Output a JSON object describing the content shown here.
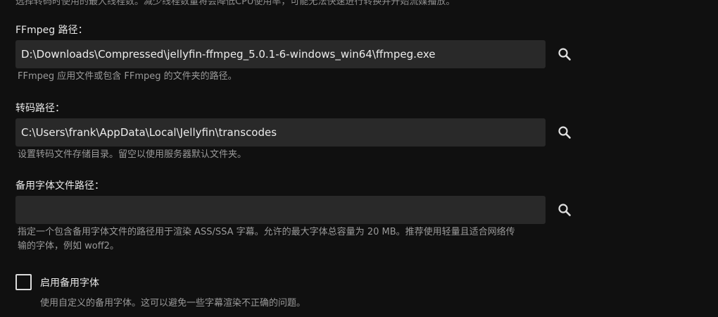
{
  "top_partial_text": "选择转码时使用的最大线程数。减少线程数量将会降低CPU使用率，可能无法快速进行转换并开始流媒播放。",
  "ffmpeg": {
    "label": "FFmpeg 路径：",
    "value": "D:\\Downloads\\Compressed\\jellyfin-ffmpeg_5.0.1-6-windows_win64\\ffmpeg.exe",
    "description": "FFmpeg 应用文件或包含 FFmpeg 的文件夹的路径。",
    "icon": "search-icon"
  },
  "transcode": {
    "label": "转码路径：",
    "value": "C:\\Users\\frank\\AppData\\Local\\Jellyfin\\transcodes",
    "description": "设置转码文件存储目录。留空以使用服务器默认文件夹。",
    "icon": "search-icon"
  },
  "fallback_font": {
    "label": "备用字体文件路径：",
    "value": "",
    "description_line1": "指定一个包含备用字体文件的路径用于渲染 ASS/SSA 字幕。允许的最大字体总容量为 20 MB。推荐使用轻量且适合网络传",
    "description_line2": "输的字体，例如 woff2。",
    "icon": "search-icon"
  },
  "enable_fallback_font": {
    "label": "启用备用字体",
    "checked": false,
    "description": "使用自定义的备用字体。这可以避免一些字幕渲染不正确的问题。"
  },
  "colors": {
    "background": "#101010",
    "input_background": "#292929",
    "text": "#e8e8e8",
    "muted_text": "#9a9a9a"
  }
}
